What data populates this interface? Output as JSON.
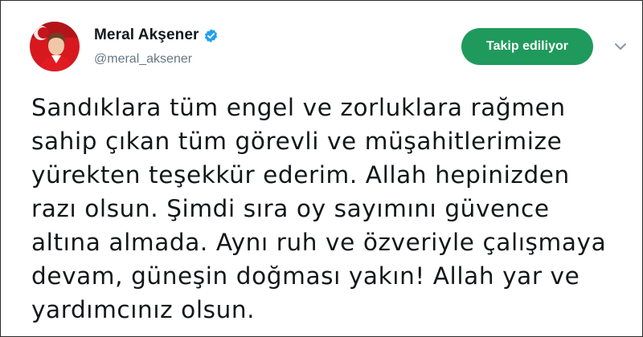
{
  "tweet": {
    "author_name": "Meral Akşener",
    "handle": "@meral_aksener",
    "verified": true,
    "follow_label": "Takip ediliyor",
    "lines": [
      "Sandıklara tüm engel ve zorluklara rağmen",
      "sahip çıkan tüm görevli ve müşahitlerimize",
      "yürekten teşekkür ederim. Allah hepinizden",
      "razı olsun. Şimdi sıra oy sayımını güvence",
      "altına almada. Aynı ruh ve özveriyle çalışmaya",
      "devam, güneşin doğması yakın! Allah yar ve",
      "yardımcınız olsun."
    ]
  },
  "icons": {
    "avatar": "profile-photo",
    "verified": "verified-badge-icon",
    "menu": "chevron-down-icon"
  },
  "colors": {
    "follow_button": "#1f9a5c",
    "verified_badge": "#1da1f2",
    "handle_text": "#657786",
    "body_text": "#14171a"
  }
}
